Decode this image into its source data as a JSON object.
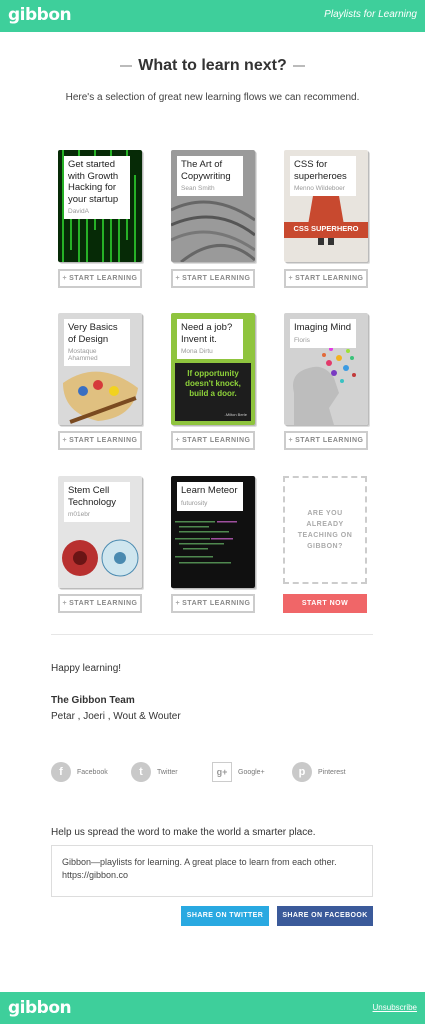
{
  "header": {
    "logo": "gibbon",
    "tagline": "Playlists for Learning"
  },
  "main": {
    "heading": "What to learn next?",
    "subheading": "Here's a selection of great new learning flows we can recommend."
  },
  "cards": [
    {
      "title": "Get started with Growth Hacking for your startup",
      "author": "DavidA",
      "button": "START LEARNING"
    },
    {
      "title": "The Art of Copywriting",
      "author": "Sean Smith",
      "button": "START LEARNING"
    },
    {
      "title": "CSS for superheroes",
      "author": "Menno Wildeboer",
      "button": "START LEARNING",
      "image_text": "CSS SUPERHERO"
    },
    {
      "title": "Very Basics of Design",
      "author": "Mostaque Ahammed",
      "button": "START LEARNING"
    },
    {
      "title": "Need a job? Invent it.",
      "author": "Mona Dirtu",
      "button": "START LEARNING",
      "image_text": "If opportunity doesn't knock, build a door.",
      "image_caption": "-Milton Berle"
    },
    {
      "title": "Imaging Mind",
      "author": "Floris",
      "button": "START LEARNING"
    },
    {
      "title": "Stem Cell Technology",
      "author": "m01ebr",
      "button": "START LEARNING"
    },
    {
      "title": "Learn Meteor",
      "author": "futurosity",
      "button": "START LEARNING"
    }
  ],
  "teaching_cta": {
    "text": "ARE YOU ALREADY TEACHING ON GIBBON?",
    "button": "START NOW"
  },
  "signoff": {
    "greeting": "Happy learning!",
    "team": "The Gibbon Team",
    "names": "Petar , Joeri , Wout & Wouter"
  },
  "social": [
    {
      "label": "Facebook",
      "icon": "facebook-icon"
    },
    {
      "label": "Twitter",
      "icon": "twitter-icon"
    },
    {
      "label": "Google+",
      "icon": "google-plus-icon"
    },
    {
      "label": "Pinterest",
      "icon": "pinterest-icon"
    }
  ],
  "share": {
    "prompt": "Help us spread the word to make the world a smarter place.",
    "message": "Gibbon—playlists for learning. A great place to learn from each other. https://gibbon.co",
    "twitter_button": "SHARE ON TWITTER",
    "facebook_button": "SHARE ON FACEBOOK"
  },
  "footer": {
    "logo": "gibbon",
    "unsubscribe": "Unsubscribe"
  },
  "colors": {
    "brand": "#3ecf9b",
    "cta_red": "#f06668",
    "twitter": "#29a9e1",
    "facebook": "#3b5a9a"
  }
}
